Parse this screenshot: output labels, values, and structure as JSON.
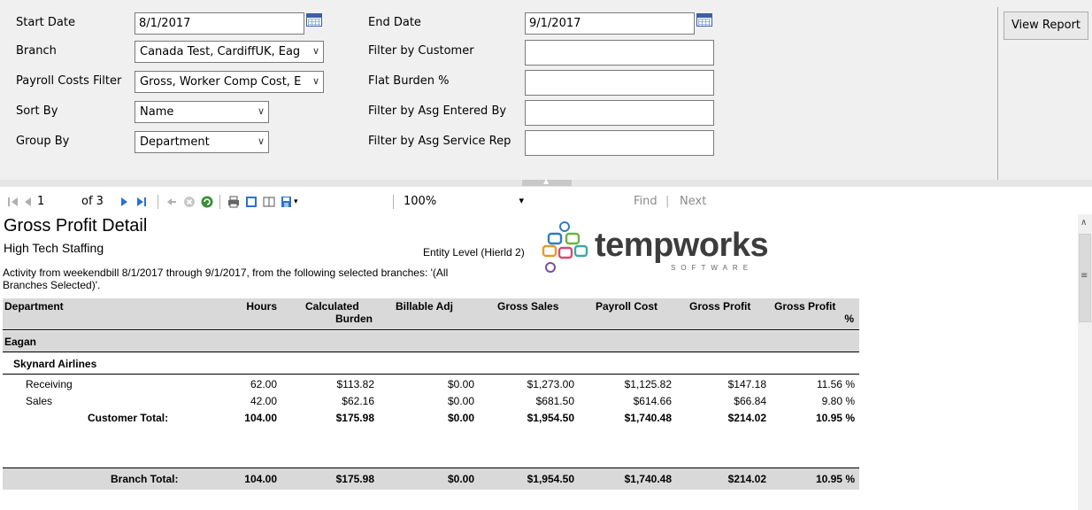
{
  "params": {
    "start_date_label": "Start Date",
    "start_date_value": "8/1/2017",
    "end_date_label": "End Date",
    "end_date_value": "9/1/2017",
    "branch_label": "Branch",
    "branch_value": "Canada Test, CardiffUK, Eag",
    "filter_customer_label": "Filter by Customer",
    "filter_customer_value": "",
    "payroll_label": "Payroll Costs Filter",
    "payroll_value": "Gross, Worker Comp Cost, E",
    "flat_burden_label": "Flat Burden %",
    "flat_burden_value": "",
    "sort_label": "Sort By",
    "sort_value": "Name",
    "asg_entered_label": "Filter by Asg Entered By",
    "asg_entered_value": "",
    "group_label": "Group By",
    "group_value": "Department",
    "asg_service_label": "Filter by Asg Service Rep",
    "asg_service_value": "",
    "view_report_label": "View Report"
  },
  "toolbar": {
    "page_current": "1",
    "page_of": "of 3",
    "zoom": "100%",
    "find_label": "Find",
    "separator": "|",
    "next_label": "Next"
  },
  "report": {
    "title": "Gross Profit Detail",
    "company": "High Tech Staffing",
    "entity_level": "Entity Level (Hierld 2)",
    "activity_line1": "Activity from weekendbill 8/1/2017 through 9/1/2017, from the following selected branches: '(All",
    "activity_line2": "Branches Selected)'.",
    "logo_text": "tempworks",
    "logo_sub": "SOFTWARE",
    "columns": {
      "department": "Department",
      "hours": "Hours",
      "calc_burden_1": "Calculated",
      "calc_burden_2": "Burden",
      "billable_adj": "Billable Adj",
      "gross_sales": "Gross Sales",
      "payroll_cost": "Payroll Cost",
      "gross_profit": "Gross Profit",
      "gross_profit_pct_1": "Gross Profit",
      "gross_profit_pct_2": "%"
    },
    "branch_name": "Eagan",
    "customer_name": "Skynard Airlines",
    "rows": [
      {
        "dept": "Receiving",
        "hours": "62.00",
        "burden": "$113.82",
        "billable": "$0.00",
        "sales": "$1,273.00",
        "payroll": "$1,125.82",
        "profit": "$147.18",
        "pct": "11.56 %"
      },
      {
        "dept": "Sales",
        "hours": "42.00",
        "burden": "$62.16",
        "billable": "$0.00",
        "sales": "$681.50",
        "payroll": "$614.66",
        "profit": "$66.84",
        "pct": "9.80 %"
      }
    ],
    "customer_total": {
      "label": "Customer Total:",
      "hours": "104.00",
      "burden": "$175.98",
      "billable": "$0.00",
      "sales": "$1,954.50",
      "payroll": "$1,740.48",
      "profit": "$214.02",
      "pct": "10.95 %"
    },
    "branch_total": {
      "label": "Branch Total:",
      "hours": "104.00",
      "burden": "$175.98",
      "billable": "$0.00",
      "sales": "$1,954.50",
      "payroll": "$1,740.48",
      "profit": "$214.02",
      "pct": "10.95 %"
    }
  },
  "icons": {
    "first_page": "first-page-icon",
    "prev_page": "prev-page-icon",
    "next_page": "next-page-icon",
    "last_page": "last-page-icon",
    "back": "back-icon",
    "stop": "stop-icon",
    "refresh": "refresh-icon",
    "print": "print-icon",
    "print_layout": "print-layout-icon",
    "page_setup": "page-setup-icon",
    "export": "export-icon",
    "calendar": "calendar-icon"
  },
  "colors": {
    "panel_bg": "#f0f0f0",
    "header_gray": "#d9d9d9",
    "toolbar_blue": "#2f6fd0",
    "logo_dark": "#3c3c3c"
  }
}
